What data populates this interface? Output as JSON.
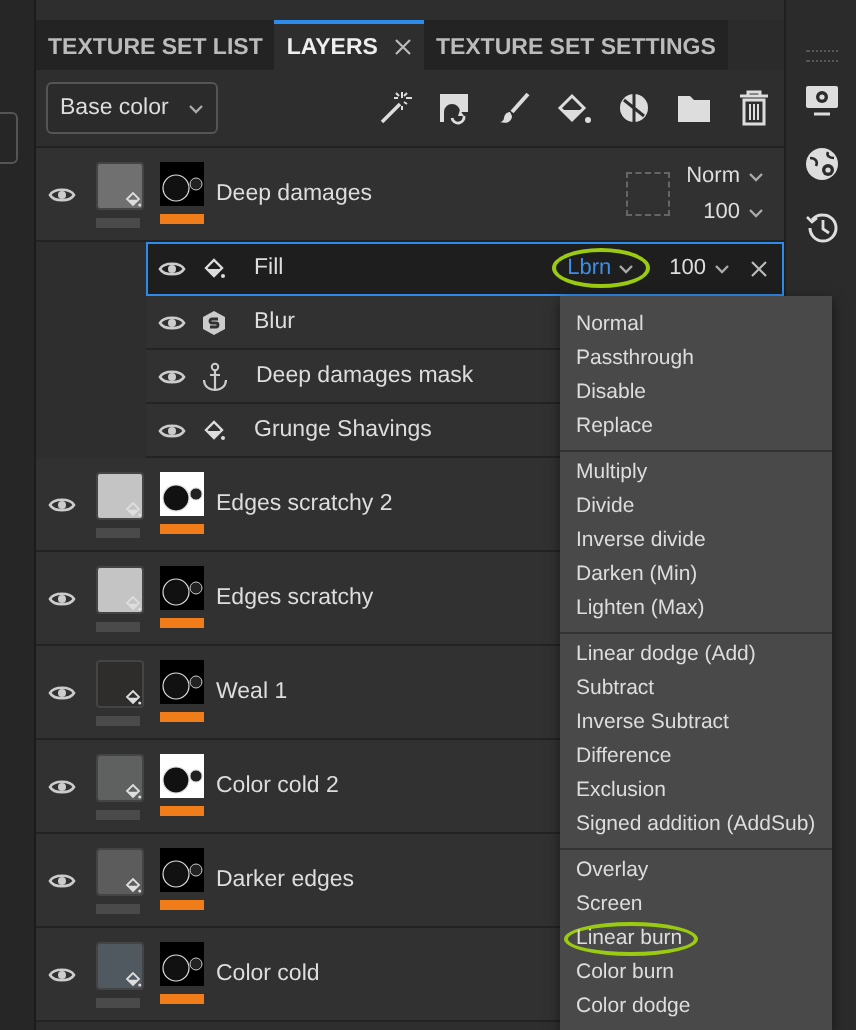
{
  "tabs": [
    {
      "label": "TEXTURE SET LIST",
      "selected": false,
      "closable": false
    },
    {
      "label": "LAYERS",
      "selected": true,
      "closable": true
    },
    {
      "label": "TEXTURE SET SETTINGS",
      "selected": false,
      "closable": false
    }
  ],
  "channel_dropdown": {
    "value": "Base color"
  },
  "layers": [
    {
      "name": "Deep damages",
      "color": "#707070",
      "blend": "Norm",
      "opacity": "100",
      "sublayers": [
        {
          "kind": "fill",
          "name": "Fill",
          "selected": true,
          "blend": "Lbrn",
          "opacity": "100",
          "circled": true
        },
        {
          "kind": "filter",
          "name": "Blur",
          "selected": false
        },
        {
          "kind": "anchor",
          "name": "Deep damages mask",
          "selected": false
        },
        {
          "kind": "fill",
          "name": "Grunge Shavings",
          "selected": false
        }
      ]
    },
    {
      "name": "Edges scratchy 2",
      "color": "#c4c4c4"
    },
    {
      "name": "Edges scratchy",
      "color": "#c4c4c4"
    },
    {
      "name": "Weal 1",
      "color": "#2f2c2c"
    },
    {
      "name": "Color cold 2",
      "color": "#5e6160"
    },
    {
      "name": "Darker edges",
      "color": "#5c5c5c"
    },
    {
      "name": "Color cold",
      "color": "#505860"
    }
  ],
  "blend_menu": {
    "sections": [
      [
        {
          "label": "Normal",
          "circled": false
        },
        {
          "label": "Passthrough",
          "circled": false
        },
        {
          "label": "Disable",
          "circled": false
        },
        {
          "label": "Replace",
          "circled": false
        }
      ],
      [
        {
          "label": "Multiply",
          "circled": false
        },
        {
          "label": "Divide",
          "circled": false
        },
        {
          "label": "Inverse divide",
          "circled": false
        },
        {
          "label": "Darken (Min)",
          "circled": false
        },
        {
          "label": "Lighten (Max)",
          "circled": false
        }
      ],
      [
        {
          "label": "Linear dodge (Add)",
          "circled": false
        },
        {
          "label": "Subtract",
          "circled": false
        },
        {
          "label": "Inverse Subtract",
          "circled": false
        },
        {
          "label": "Difference",
          "circled": false
        },
        {
          "label": "Exclusion",
          "circled": false
        },
        {
          "label": "Signed addition (AddSub)",
          "circled": false
        }
      ],
      [
        {
          "label": "Overlay",
          "circled": false
        },
        {
          "label": "Screen",
          "circled": false
        },
        {
          "label": "Linear burn",
          "circled": true
        },
        {
          "label": "Color burn",
          "circled": false
        },
        {
          "label": "Color dodge",
          "circled": false
        }
      ]
    ]
  }
}
